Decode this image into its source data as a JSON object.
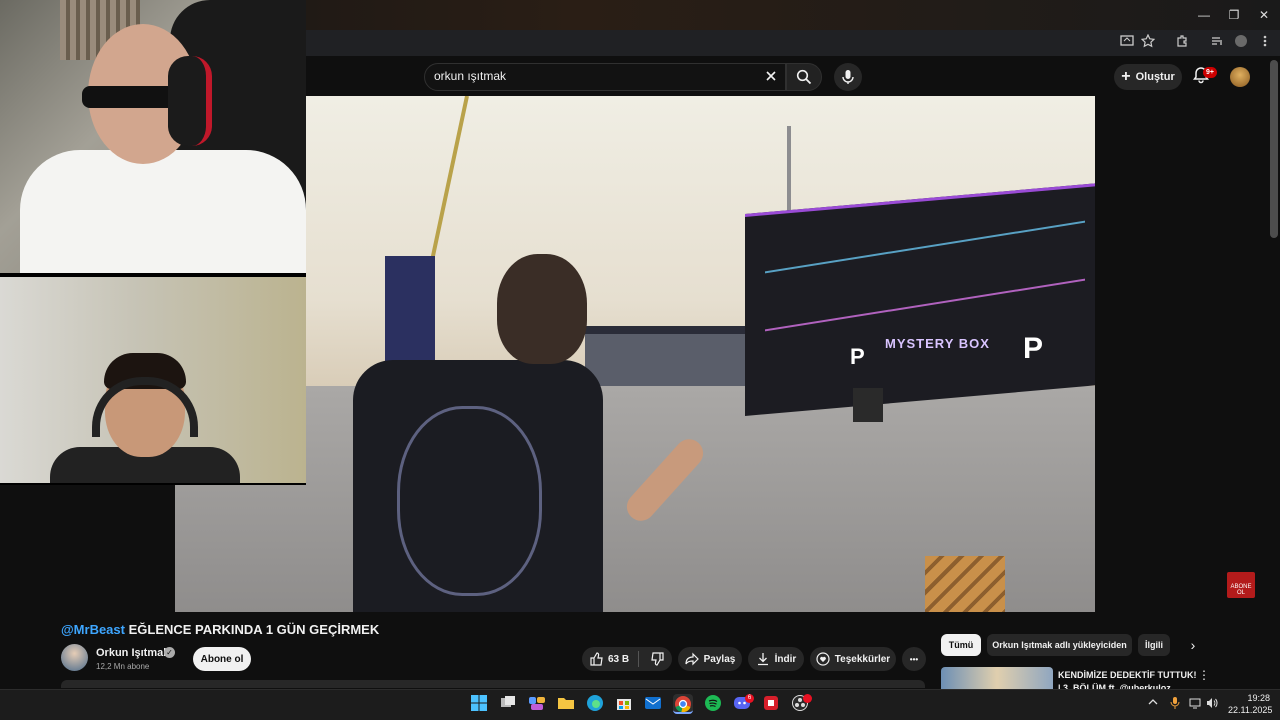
{
  "browser": {
    "window_controls": {
      "minimize": "—",
      "maximize": "❐",
      "close": "✕"
    }
  },
  "youtube": {
    "search": {
      "query": "orkun ışıtmak"
    },
    "create_label": "Oluştur",
    "notifications_badge": "9+"
  },
  "video": {
    "title_mention": "@MrBeast",
    "title_rest": " EĞLENCE PARKINDA 1 GÜN GEÇİRMEK",
    "sign_text": "MYSTERY BOX",
    "sign_logo": "P",
    "watermark": "ABONE OL"
  },
  "channel": {
    "name": "Orkun Işıtmak",
    "verified": "✓",
    "subscribers": "12,2 Mn abone",
    "subscribe_label": "Abone ol"
  },
  "actions": {
    "likes": "63 B",
    "share": "Paylaş",
    "download": "İndir",
    "thanks": "Teşekkürler",
    "more": "•••"
  },
  "sidebar": {
    "chips": [
      "Tümü",
      "Orkun Işıtmak adlı yükleyiciden",
      "İlgili"
    ],
    "next": "›",
    "rec_title": "KENDİMİZE DEDEKTİF TUTTUK! | 3. BÖLÜM ft. @uberkuloz",
    "rec_more": "⋮"
  },
  "taskbar": {
    "time": "19:28",
    "date": "22.11.2025",
    "discord_badge": "6"
  },
  "colors": {
    "background": "#0f0f0f",
    "accent_link": "#3ea6ff",
    "youtube_red": "#cc0000"
  }
}
